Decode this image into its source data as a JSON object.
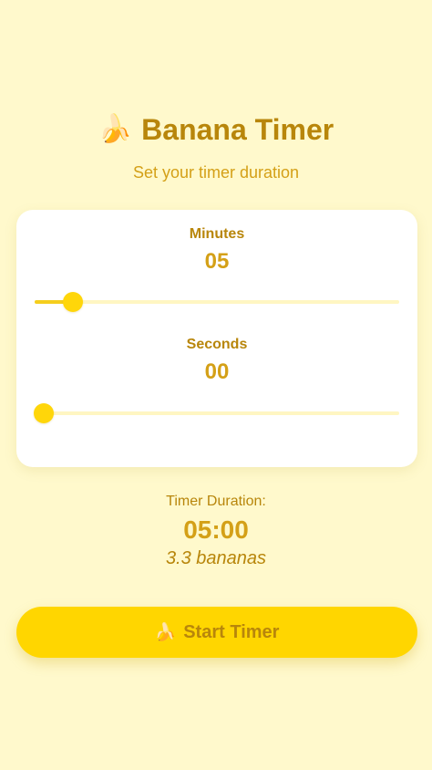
{
  "header": {
    "icon": "banana-icon",
    "icon_glyph": "🍌",
    "title": "Banana Timer",
    "subtitle": "Set your timer duration"
  },
  "minutes": {
    "label": "Minutes",
    "value": "05",
    "slider_fraction": 0.105
  },
  "seconds": {
    "label": "Seconds",
    "value": "00",
    "slider_fraction": 0.025
  },
  "duration": {
    "label": "Timer Duration:",
    "value": "05:00",
    "bananas": "3.3 bananas"
  },
  "start_button": {
    "icon": "banana-icon",
    "icon_glyph": "🍌",
    "label": "Start Timer"
  },
  "colors": {
    "background": "#FFF9CC",
    "accent": "#FFD600",
    "text_dark": "#B8860B",
    "text_light": "#D4A017"
  }
}
